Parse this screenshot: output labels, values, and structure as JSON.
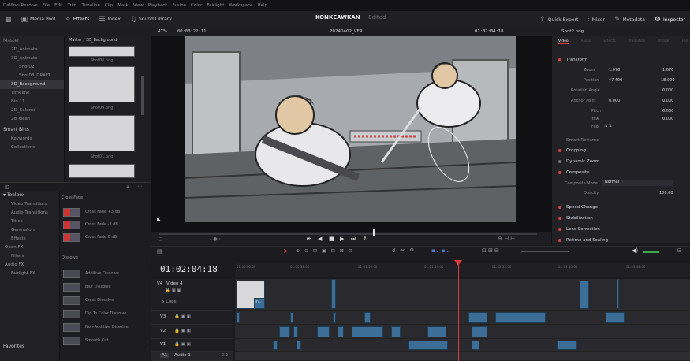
{
  "menubar": {
    "items": [
      "DaVinci Resolve",
      "File",
      "Edit",
      "Trim",
      "Timeline",
      "Clip",
      "Mark",
      "View",
      "Playback",
      "Fusion",
      "Color",
      "Fairlight",
      "Workspace",
      "Help"
    ]
  },
  "toolbar": {
    "media_pool": "Media Pool",
    "effects": "Effects",
    "index": "Index",
    "sound_library": "Sound Library",
    "project_name": "KONKEAWKAN",
    "project_status": "Edited",
    "quick_export": "Quick Export",
    "mixer": "Mixer",
    "metadata": "Metadata",
    "inspector": "Inspector"
  },
  "subbar": {
    "zoom": "47%",
    "source_timecode": "00:03:22:11",
    "timeline_name": "20240402_VER",
    "record_timecode": "01:02:04:18",
    "clip_name": "Shot2.png"
  },
  "bins": {
    "header": "Master",
    "items": [
      "2D_Animate",
      "3D_Animate",
      "Shot02",
      "Shot08_DRAFT",
      "3D_Background",
      "Timeline",
      "Bin 11",
      "2D_Colored",
      "2d_clean"
    ],
    "selected_index": 4,
    "smart_bins": "Smart Bins",
    "smart_items": [
      "Keywords",
      "Collections"
    ]
  },
  "media": {
    "path": "Master / 3D_Background",
    "thumbs": [
      "Shot08.png",
      "Shot09.png",
      "Shot01.png"
    ]
  },
  "effects_panel": {
    "toolbox": "Toolbox",
    "categories": [
      "Video Transitions",
      "Audio Transitions",
      "Titles",
      "Generators",
      "Effects",
      "Open FX",
      "Filters",
      "Audio FX",
      "Fairlight FX"
    ],
    "favorites": "Favorites",
    "section_cross_fade": "Cross Fade",
    "cross_fade_items": [
      "Cross Fade +3 dB",
      "Cross Fade -3 dB",
      "Cross Fade 0 dB"
    ],
    "section_dissolve": "Dissolve",
    "dissolve_items": [
      "Additive Dissolve",
      "Blur Dissolve",
      "Cross Dissolve",
      "Dip To Color Dissolve",
      "Non-Additive Dissolve",
      "Smooth Cut"
    ]
  },
  "inspector": {
    "tabs": [
      "Video",
      "Audio",
      "Effects",
      "Transition",
      "Image",
      "File"
    ],
    "transform": "Transform",
    "zoom_label": "Zoom",
    "zoom_x": "1.070",
    "zoom_y": "1.070",
    "position_label": "Position",
    "position_x": "-47.400",
    "position_y": "18.000",
    "rotation_label": "Rotation Angle",
    "rotation_value": "0.000",
    "anchor_label": "Anchor Point",
    "anchor_x": "0.000",
    "anchor_y": "0.000",
    "pitch_label": "Pitch",
    "pitch_value": "0.000",
    "yaw_label": "Yaw",
    "yaw_value": "0.000",
    "flip_label": "Flip",
    "smart_reframe": "Smart Reframe",
    "cropping": "Cropping",
    "dynamic_zoom": "Dynamic Zoom",
    "composite": "Composite",
    "composite_mode_label": "Composite Mode",
    "composite_mode_value": "Normal",
    "opacity_label": "Opacity",
    "opacity_value": "100.00",
    "speed_change": "Speed Change",
    "stabilization": "Stabilization",
    "lens_correction": "Lens Correction",
    "retime_scaling": "Retime and Scaling"
  },
  "timeline": {
    "timecode": "01:02:04:18",
    "ruler_marks": [
      "01:00:00:00",
      "01:00:38:00",
      "01:01:16:00",
      "01:01:54:00",
      "01:02:32:00",
      "01:03:10:00",
      "01:03:48:00"
    ],
    "tracks": [
      {
        "id": "V4",
        "name": "Video 4",
        "clips_label": "5 Clips"
      },
      {
        "id": "V3",
        "name": ""
      },
      {
        "id": "V2",
        "name": ""
      },
      {
        "id": "V1",
        "name": ""
      },
      {
        "id": "A1",
        "name": "Audio 1",
        "level": "2.0"
      }
    ],
    "clip_text": "sh..."
  },
  "colors": {
    "accent_red": "#e03a3a",
    "clip_blue": "#3c6e97",
    "panel_bg": "#222226"
  }
}
